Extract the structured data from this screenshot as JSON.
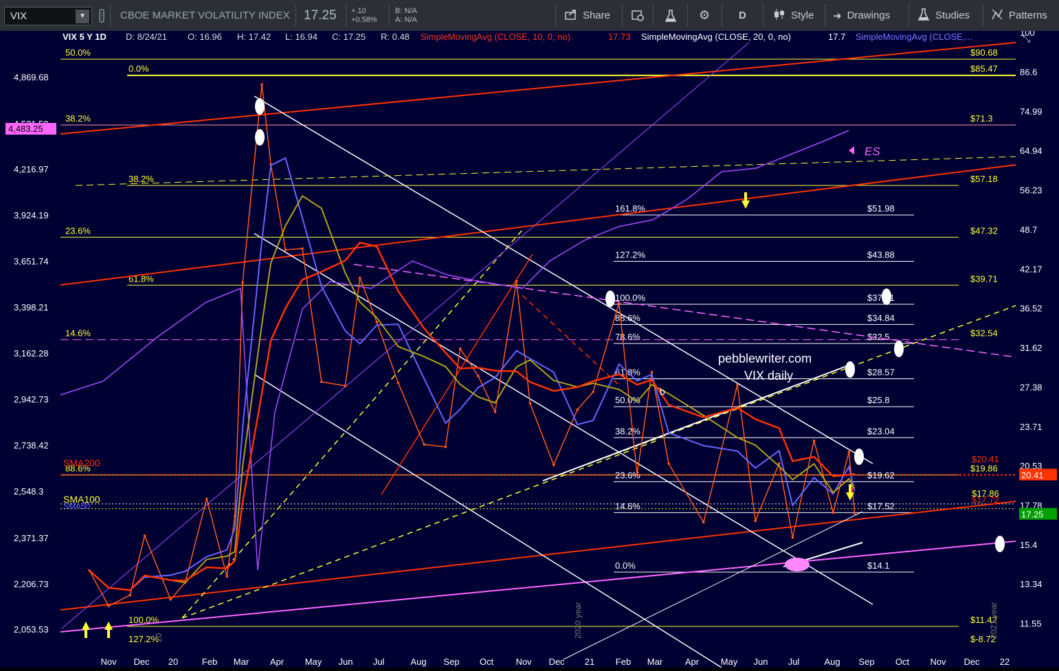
{
  "toolbar": {
    "symbol": "VIX",
    "description": "CBOE MARKET VOLATILITY INDEX",
    "last": "17.25",
    "change": "+.10",
    "change_pct": "+0.58%",
    "bid": "B: N/A",
    "ask": "A: N/A",
    "share": "Share",
    "period": "D",
    "style": "Style",
    "drawings": "Drawings",
    "studies": "Studies",
    "patterns": "Patterns"
  },
  "header": {
    "title": "VIX 5 Y 1D",
    "date": "D: 8/24/21",
    "open": "O: 16.96",
    "high": "H: 17.42",
    "low": "L: 16.94",
    "close": "C: 17.25",
    "range": "R: 0.48",
    "sma10": "SimpleMovingAvg (CLOSE, 10, 0, no)",
    "sma10_val": "17.73",
    "sma20": "SimpleMovingAvg (CLOSE, 20, 0, no)",
    "sma20_val": "17.7",
    "sma50": "SimpleMovingAvg (CLOSE,..."
  },
  "colors": {
    "background": "#000033",
    "yellow": "#ffff33",
    "red": "#ff3300",
    "orange": "#ff5a1a",
    "white": "#ffffff",
    "magenta": "#ff66ff",
    "purple": "#a64dff",
    "blue": "#6666ff",
    "olive": "#b3a21a"
  },
  "annotations": {
    "site": "pebblewriter.com",
    "subtitle": "VIX daily",
    "es": "ES",
    "sma200": "SMA200",
    "sma100": "SMA100",
    "sma50": "SMA50",
    "b": "b",
    "year2020": "2020 year",
    "year2021": "2021 year",
    "year20": "20"
  },
  "chart_data": {
    "type": "line",
    "title": "VIX 5 Y 1D",
    "x_ticks": [
      "Nov",
      "Dec",
      "20",
      "Feb",
      "Mar",
      "Apr",
      "May",
      "Jun",
      "Jul",
      "Aug",
      "Sep",
      "Oct",
      "Nov",
      "Dec",
      "21",
      "Feb",
      "Mar",
      "Apr",
      "May",
      "Jun",
      "Jul",
      "Aug",
      "Sep",
      "Oct",
      "Nov",
      "Dec",
      "22"
    ],
    "right_axis": [
      "100",
      "86.6",
      "74.99",
      "64.94",
      "56.23",
      "48.7",
      "42.17",
      "36.52",
      "31.62",
      "27.38",
      "23.71",
      "20.53",
      "17.78",
      "15.4",
      "13.34",
      "11.55"
    ],
    "left_axis": [
      "4,869.68",
      "4,531.58",
      "4,216.97",
      "3,924.19",
      "3,651.74",
      "3,398.21",
      "3,162.28",
      "2,942.73",
      "2,738.42",
      "2,548.3",
      "2,371.37",
      "2,206.73",
      "2,053.53"
    ],
    "left_axis_marker": "4,483.25",
    "right_axis_markers": [
      {
        "label": "20.41",
        "color": "#ff3300"
      },
      {
        "label": "17.25",
        "color": "#00a000"
      }
    ],
    "fib_left": [
      {
        "label": "50.0%",
        "value": "$90.68"
      },
      {
        "label": "0.0%",
        "value": "$85.47"
      },
      {
        "label": "38.2%",
        "value": "$71.3"
      },
      {
        "label": "38.2%",
        "value": "$57.18"
      },
      {
        "label": "23.6%",
        "value": "$47.32"
      },
      {
        "label": "61.8%",
        "value": "$39.71"
      },
      {
        "label": "14.6%",
        "value": "$32.54"
      },
      {
        "label": "88.6%",
        "value": "$19.86"
      },
      {
        "label": "100.0%",
        "value": "$11.42"
      },
      {
        "label": "127.2%",
        "value": "$-8.72"
      }
    ],
    "fib_mid": [
      {
        "label": "161.8%",
        "value": "$51.98"
      },
      {
        "label": "127.2%",
        "value": "$43.88"
      },
      {
        "label": "100.0%",
        "value": "$37.51"
      },
      {
        "label": "88.6%",
        "value": "$34.84"
      },
      {
        "label": "78.6%",
        "value": "$32.5"
      },
      {
        "label": "61.8%",
        "value": "$28.57"
      },
      {
        "label": "50.0%",
        "value": "$25.8"
      },
      {
        "label": "38.2%",
        "value": "$23.04"
      },
      {
        "label": "23.6%",
        "value": "$19.62"
      },
      {
        "label": "14.6%",
        "value": "$17.52"
      },
      {
        "label": "0.0%",
        "value": "$14.1"
      }
    ],
    "other_levels": [
      "$20.41",
      "$17.86",
      "$17.72"
    ],
    "vix_series": [
      [
        "2019-10-15",
        14.0
      ],
      [
        "2019-11-01",
        12.3
      ],
      [
        "2019-11-20",
        12.8
      ],
      [
        "2019-12-03",
        15.9
      ],
      [
        "2019-12-26",
        12.6
      ],
      [
        "2020-01-08",
        13.4
      ],
      [
        "2020-01-27",
        18.2
      ],
      [
        "2020-02-14",
        13.7
      ],
      [
        "2020-02-21",
        17.1
      ],
      [
        "2020-02-28",
        40.1
      ],
      [
        "2020-03-16",
        82.7
      ],
      [
        "2020-03-24",
        61.7
      ],
      [
        "2020-04-06",
        45.2
      ],
      [
        "2020-04-21",
        45.4
      ],
      [
        "2020-05-08",
        27.9
      ],
      [
        "2020-05-29",
        27.5
      ],
      [
        "2020-06-11",
        40.8
      ],
      [
        "2020-06-26",
        34.7
      ],
      [
        "2020-07-15",
        27.8
      ],
      [
        "2020-08-07",
        22.2
      ],
      [
        "2020-08-26",
        22.0
      ],
      [
        "2020-09-08",
        31.5
      ],
      [
        "2020-09-24",
        28.5
      ],
      [
        "2020-10-09",
        25.0
      ],
      [
        "2020-10-28",
        40.3
      ],
      [
        "2020-11-09",
        25.8
      ],
      [
        "2020-11-30",
        20.6
      ],
      [
        "2020-12-21",
        25.2
      ],
      [
        "2021-01-04",
        26.9
      ],
      [
        "2021-01-27",
        37.2
      ],
      [
        "2021-02-12",
        19.9
      ],
      [
        "2021-02-25",
        28.9
      ],
      [
        "2021-03-12",
        20.7
      ],
      [
        "2021-04-12",
        16.7
      ],
      [
        "2021-05-12",
        27.6
      ],
      [
        "2021-05-28",
        16.8
      ],
      [
        "2021-06-18",
        20.7
      ],
      [
        "2021-06-30",
        15.8
      ],
      [
        "2021-07-19",
        22.5
      ],
      [
        "2021-08-05",
        17.3
      ],
      [
        "2021-08-19",
        21.6
      ],
      [
        "2021-08-24",
        17.25
      ]
    ],
    "y_scale": "log"
  }
}
